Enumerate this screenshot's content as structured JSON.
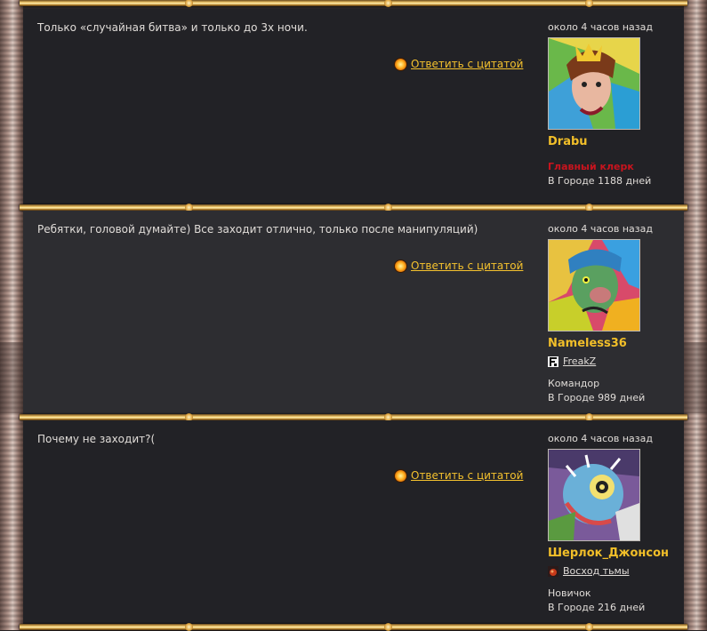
{
  "posts": [
    {
      "text": "Только «случайная битва» и только до 3х ночи.",
      "quote_label": "Ответить с цитатой",
      "time": "около 4 часов назад",
      "username": "Drabu",
      "clan": "",
      "rank": "Главный клерк",
      "days": "В Городе 1188 дней"
    },
    {
      "text": "Ребятки, головой думайте) Все заходит отлично, только после манипуляций)",
      "quote_label": "Ответить с цитатой",
      "time": "около 4 часов назад",
      "username": "Nameless36",
      "clan": "FreakZ",
      "rank": "Командор",
      "days": "В Городе 989 дней"
    },
    {
      "text": "Почему не заходит?(",
      "quote_label": "Ответить с цитатой",
      "time": "около 4 часов назад",
      "username": "Шерлок_Джонсон",
      "clan": "Восход тьмы",
      "rank": "Новичок",
      "days": "В Городе 216 дней"
    }
  ],
  "colors": {
    "username": "#f2bf29",
    "quote_link": "#f5c22e",
    "rank_staff": "#c8141e",
    "post_bg": "#222226",
    "post_bg_alt": "#2d2d31"
  },
  "icons": {
    "quote": "quote-sun-icon",
    "clan_freakz": "clan-freakz-icon",
    "clan_voshod": "clan-voshod-icon"
  }
}
